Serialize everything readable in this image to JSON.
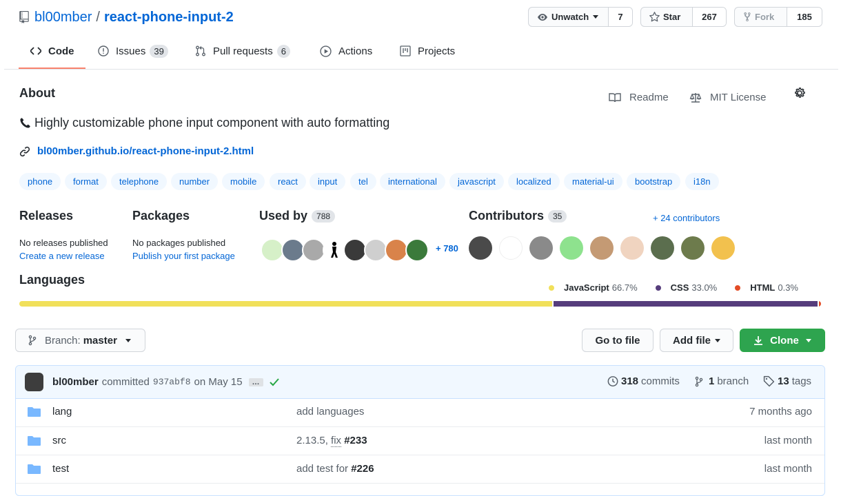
{
  "repo": {
    "owner": "bl00mber",
    "separator": "/",
    "name": "react-phone-input-2"
  },
  "header_buttons": {
    "watch": {
      "label": "Unwatch",
      "count": "7"
    },
    "star": {
      "label": "Star",
      "count": "267"
    },
    "fork": {
      "label": "Fork",
      "count": "185"
    }
  },
  "tabs": [
    {
      "label": "Code",
      "icon": "code-icon"
    },
    {
      "label": "Issues",
      "count": "39",
      "icon": "issue-icon"
    },
    {
      "label": "Pull requests",
      "count": "6",
      "icon": "pull-request-icon"
    },
    {
      "label": "Actions",
      "icon": "play-icon"
    },
    {
      "label": "Projects",
      "icon": "project-icon"
    }
  ],
  "about": {
    "heading": "About",
    "description": "Highly customizable phone input component with auto formatting",
    "link": "bl00mber.github.io/react-phone-input-2.html",
    "readme": "Readme",
    "license": "MIT License",
    "topics": [
      "phone",
      "format",
      "telephone",
      "number",
      "mobile",
      "react",
      "input",
      "tel",
      "international",
      "javascript",
      "localized",
      "material-ui",
      "bootstrap",
      "i18n"
    ]
  },
  "releases": {
    "heading": "Releases",
    "text": "No releases published",
    "link": "Create a new release"
  },
  "packages": {
    "heading": "Packages",
    "text": "No packages published",
    "link": "Publish your first package"
  },
  "used_by": {
    "heading": "Used by",
    "count": "788",
    "more": "+ 780"
  },
  "contributors": {
    "heading": "Contributors",
    "count": "35",
    "more": "+ 24 contributors"
  },
  "languages": {
    "heading": "Languages",
    "items": [
      {
        "name": "JavaScript",
        "percent": "66.7%",
        "value": 66.7,
        "color": "#f1e05a"
      },
      {
        "name": "CSS",
        "percent": "33.0%",
        "value": 33.0,
        "color": "#563d7c"
      },
      {
        "name": "HTML",
        "percent": "0.3%",
        "value": 0.3,
        "color": "#e34c26"
      }
    ]
  },
  "toolbar": {
    "branch_prefix": "Branch:",
    "branch": "master",
    "go_to_file": "Go to file",
    "add_file": "Add file",
    "clone": "Clone"
  },
  "commit": {
    "author": "bl00mber",
    "verb": "committed",
    "sha": "937abf8",
    "date": "on May 15",
    "ellipsis": "…",
    "commits_count": "318",
    "commits_label": "commits",
    "branch_count": "1",
    "branch_label": "branch",
    "tags_count": "13",
    "tags_label": "tags"
  },
  "files": [
    {
      "name": "lang",
      "message": "add languages",
      "age": "7 months ago"
    },
    {
      "name": "src",
      "message_prefix": "2.13.5, ",
      "message_fix": "fix",
      "message_ref": "#233",
      "age": "last month"
    },
    {
      "name": "test",
      "message_prefix": "add test for ",
      "message_ref": "#226",
      "age": "last month"
    }
  ],
  "colors": {
    "accent": "#0366d6",
    "tab_underline": "#f9826c",
    "clone_green": "#2ea44f",
    "topic_bg": "#f1f8ff"
  }
}
